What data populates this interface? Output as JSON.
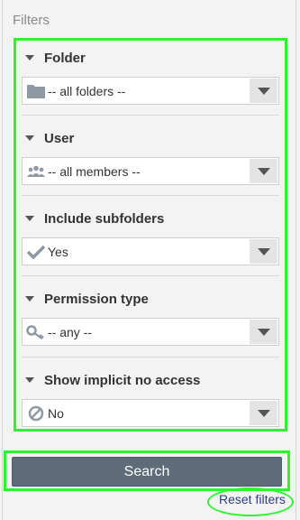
{
  "panel": {
    "title": "Filters"
  },
  "filters": [
    {
      "label": "Folder",
      "value": "-- all folders --",
      "icon": "folder-icon"
    },
    {
      "label": "User",
      "value": "-- all members --",
      "icon": "users-icon"
    },
    {
      "label": "Include subfolders",
      "value": "Yes",
      "icon": "checkmark-icon"
    },
    {
      "label": "Permission type",
      "value": "-- any --",
      "icon": "key-icon"
    },
    {
      "label": "Show implicit no access",
      "value": "No",
      "icon": "no-entry-icon"
    }
  ],
  "actions": {
    "search_label": "Search",
    "reset_label": "Reset filters"
  },
  "colors": {
    "highlight": "#2df52d",
    "button": "#5e6b78",
    "link": "#2f3b86"
  }
}
